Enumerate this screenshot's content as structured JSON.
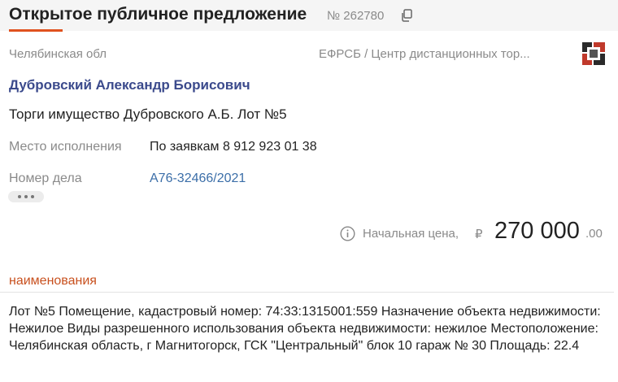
{
  "header": {
    "title": "Открытое публичное предложение",
    "number": "№ 262780"
  },
  "meta": {
    "region": "Челябинская обл",
    "source": "ЕФРСБ / Центр дистанционных тор..."
  },
  "debtor": "Дубровский Александр Борисович",
  "lot_title": "Торги имущество Дубровского А.Б. Лот №5",
  "fields": [
    {
      "label": "Место исполнения",
      "value": "По заявкам 8 912 923 01 38"
    },
    {
      "label": "Номер дела",
      "value": "А76-32466/2021"
    }
  ],
  "price": {
    "label": "Начальная цена,",
    "currency": "₽",
    "amount": "270 000",
    "cents": ".00"
  },
  "section": {
    "heading": "наименования",
    "description": "Лот №5 Помещение, кадастровый номер: 74:33:1315001:559 Назначение объекта недвижимости: Нежилое Виды разрешенного использования объекта недвижимости: нежилое Местоположение: Челябинская область, г Магнитогорск, ГСК \"Центральный\" блок 10 гараж № 30 Площадь: 22.4"
  },
  "icons": {
    "copy": "copy-icon",
    "info": "info-icon",
    "logo": "platform-logo-icon",
    "more": "more-dots-icon"
  },
  "colors": {
    "accent": "#e0521f",
    "debtor_link": "#3b4a8c",
    "case_link": "#3b6ea8",
    "section_heading": "#c8501e",
    "muted": "#8a8a8a"
  }
}
